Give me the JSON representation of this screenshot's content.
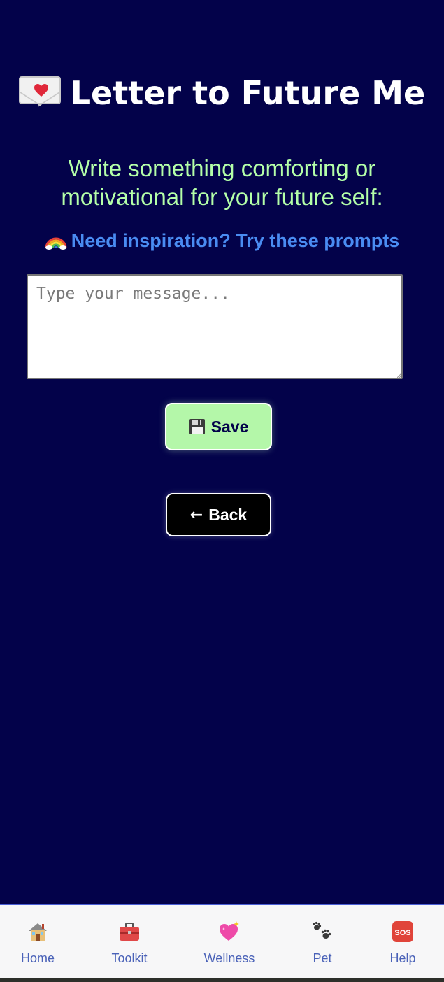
{
  "page": {
    "title": "Letter to Future Me",
    "title_icon": "love-letter-icon",
    "prompt": "Write something comforting or motivational for your future self:",
    "inspiration_link": "Need inspiration? Try these prompts",
    "inspiration_icon": "rainbow-icon"
  },
  "form": {
    "message_placeholder": "Type your message...",
    "message_value": "",
    "save_label": "Save",
    "save_icon": "floppy-disk-icon",
    "back_label": "Back",
    "back_arrow": "←"
  },
  "nav": {
    "items": [
      {
        "label": "Home",
        "icon": "house-icon"
      },
      {
        "label": "Toolkit",
        "icon": "toolbox-icon"
      },
      {
        "label": "Wellness",
        "icon": "sparkling-heart-icon"
      },
      {
        "label": "Pet",
        "icon": "paw-prints-icon"
      },
      {
        "label": "Help",
        "icon": "sos-icon"
      }
    ]
  },
  "colors": {
    "background": "#03024a",
    "title": "#ffffff",
    "prompt": "#b4ffa8",
    "link": "#4a8cf2",
    "save_button": "#b4f7a9",
    "back_button": "#000000",
    "nav_background": "#f7f7f8",
    "nav_text": "#4a62b8"
  }
}
